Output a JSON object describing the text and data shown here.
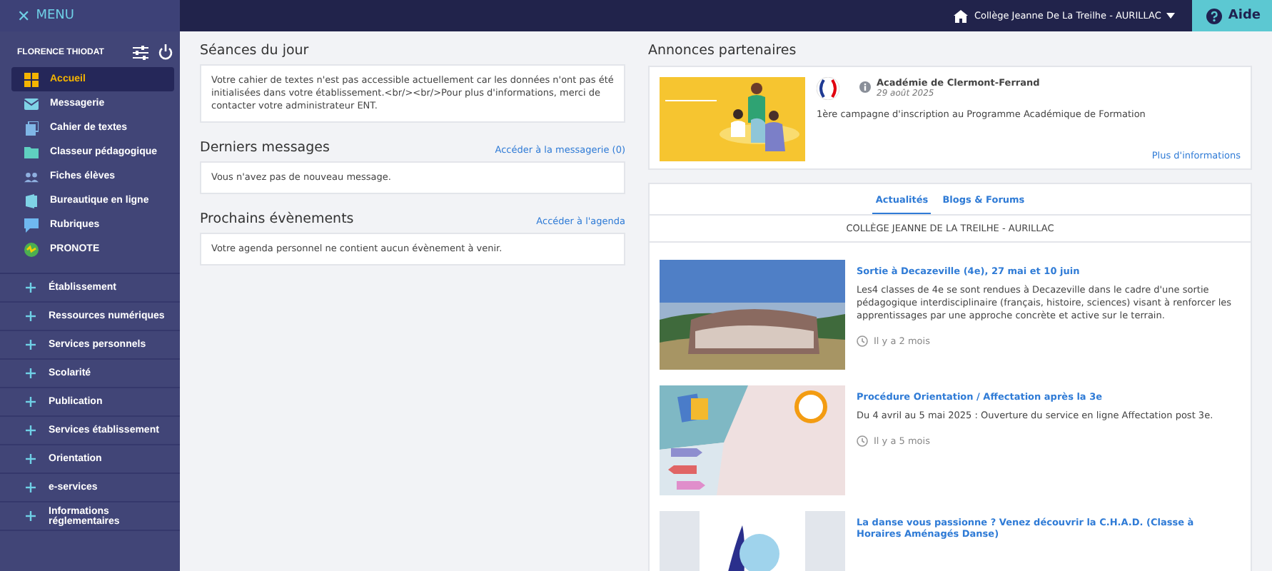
{
  "topbar": {
    "menu_label": "MENU",
    "close_icon": "✕",
    "school_selector": "Collège Jeanne De La Treilhe - AURILLAC",
    "help_button": "Aide"
  },
  "sidebar": {
    "user_name": "FLORENCE THIODAT",
    "items": [
      {
        "label": "Accueil",
        "kind": "grid",
        "selected": true
      },
      {
        "label": "Messagerie",
        "kind": "mail",
        "selected": false
      },
      {
        "label": "Cahier de textes",
        "kind": "book",
        "selected": false
      },
      {
        "label": "Classeur pédagogique",
        "kind": "folder",
        "selected": false
      },
      {
        "label": "Fiches élèves",
        "kind": "people",
        "selected": false
      },
      {
        "label": "Bureautique en ligne",
        "kind": "office",
        "selected": false
      },
      {
        "label": "Rubriques",
        "kind": "chat",
        "selected": false
      },
      {
        "label": "PRONOTE",
        "kind": "pronote",
        "selected": false
      }
    ],
    "sections": [
      {
        "label": "Établissement",
        "expanded": false
      },
      {
        "label": "Ressources numériques",
        "expanded": false
      },
      {
        "label": "Services personnels",
        "expanded": false
      },
      {
        "label": "Scolarité",
        "expanded": false
      },
      {
        "label": "Publication",
        "expanded": false
      },
      {
        "label": "Services établissement",
        "expanded": false
      },
      {
        "label": "Orientation",
        "expanded": false
      },
      {
        "label": "e-services",
        "expanded": false
      },
      {
        "label": "Informations réglementaires",
        "expanded": false
      }
    ]
  },
  "left_panels": [
    {
      "title": "Séances du jour",
      "text": "Votre cahier de textes n'est pas accessible actuellement car les données n'ont pas été initialisées dans votre établissement.<br/><br/>Pour plus d'informations, merci de contacter votre administrateur ENT."
    },
    {
      "title": "Derniers messages",
      "link": "Accéder à la messagerie (0)",
      "text": "Vous n'avez pas de nouveau message."
    },
    {
      "title": "Prochains évènements",
      "link": "Accéder à l'agenda",
      "text": "Votre agenda personnel ne contient aucun évènement à venir."
    }
  ],
  "announcements": {
    "title": "Annonces partenaires",
    "source": "Académie de Clermont-Ferrand",
    "date": "29 août 2025",
    "text": "1ère campagne d'inscription au Programme Académique de Formation",
    "more_link": "Plus d'informations"
  },
  "news": {
    "tabs": [
      {
        "label": "Actualités",
        "selected": true
      },
      {
        "label": "Blogs & Forums",
        "selected": false
      }
    ],
    "school": "COLLÈGE JEANNE DE LA TREILHE - AURILLAC",
    "items": [
      {
        "title": "Sortie à Decazeville (4e), 27 mai et 10 juin",
        "text": "Les4 classes de 4e se sont rendues à Decazeville dans le cadre d'une sortie pédagogique interdisciplinaire (français, histoire, sciences) visant à renforcer les apprentissages par une approche concrète et active sur le terrain.",
        "age": "Il y a 2 mois"
      },
      {
        "kind": "graphic",
        "title": "Procédure Orientation / Affectation après la 3e",
        "text": "Du 4 avril au 5 mai 2025 : Ouverture du service en ligne Affectation post 3e.",
        "age": "Il y a 5 mois"
      },
      {
        "kind": "dance",
        "title": "La danse vous passionne ? Venez découvrir la C.H.A.D. (Classe à Horaires Aménagés Danse)"
      }
    ]
  }
}
